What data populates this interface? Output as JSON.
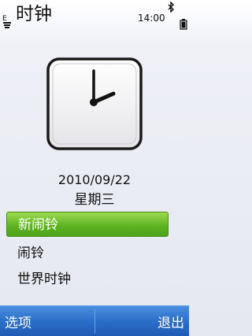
{
  "status_bar": {
    "app_title": "时钟",
    "time": "14:00",
    "signal_icon": "signal-strength-icon",
    "bluetooth_icon": "bluetooth-icon",
    "battery_icon": "battery-icon"
  },
  "clock": {
    "icon": "analog-clock-icon",
    "date": "2010/09/22",
    "weekday": "星期三"
  },
  "menu": {
    "items": [
      {
        "label": "新闹铃",
        "selected": true
      },
      {
        "label": "闹铃",
        "selected": false
      },
      {
        "label": "世界时钟",
        "selected": false
      }
    ]
  },
  "softkeys": {
    "left": "选项",
    "right": "退出"
  },
  "colors": {
    "selection": "#5fb521",
    "softkey_bar": "#2b6fc8"
  }
}
